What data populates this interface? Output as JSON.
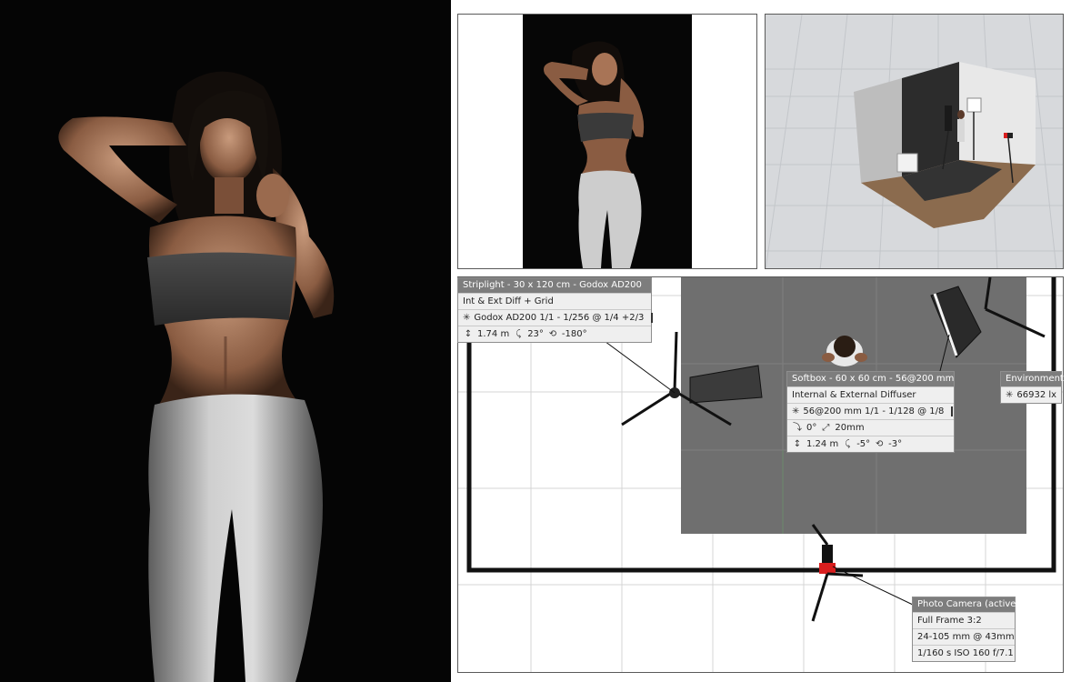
{
  "striplight": {
    "title": "Striplight - 30 x 120 cm - Godox AD200",
    "modifier": "Int & Ext Diff + Grid",
    "flash_icon": "flash-icon",
    "flash_value": "Godox AD200  1/1 - 1/256 @ 1/4 +2/3",
    "height": "1.74 m",
    "tilt": "23°",
    "rotation": "-180°"
  },
  "softbox": {
    "title": "Softbox - 60 x 60 cm - 56@200 mm",
    "modifier": "Internal & External Diffuser",
    "flash_value": "56@200 mm  1/1 - 1/128 @ 1/8",
    "angle": "0°",
    "zoom": "20mm",
    "height": "1.24 m",
    "tilt": "-5°",
    "rotation": "-3°"
  },
  "environment": {
    "title": "Environment",
    "lux": "66932 lx"
  },
  "camera": {
    "title": "Photo Camera (active)",
    "sensor": "Full Frame  3:2",
    "lens": "24-105 mm @ 43mm",
    "exposure": "1/160 s  ISO 160  f/7.1"
  },
  "colors": {
    "render_background": "#050505",
    "scene_background": "#d7d9dc",
    "backdrop_gray": "#6f6f6f",
    "info_title": "#7d7d7d",
    "camera_accent": "#d81e1e"
  }
}
